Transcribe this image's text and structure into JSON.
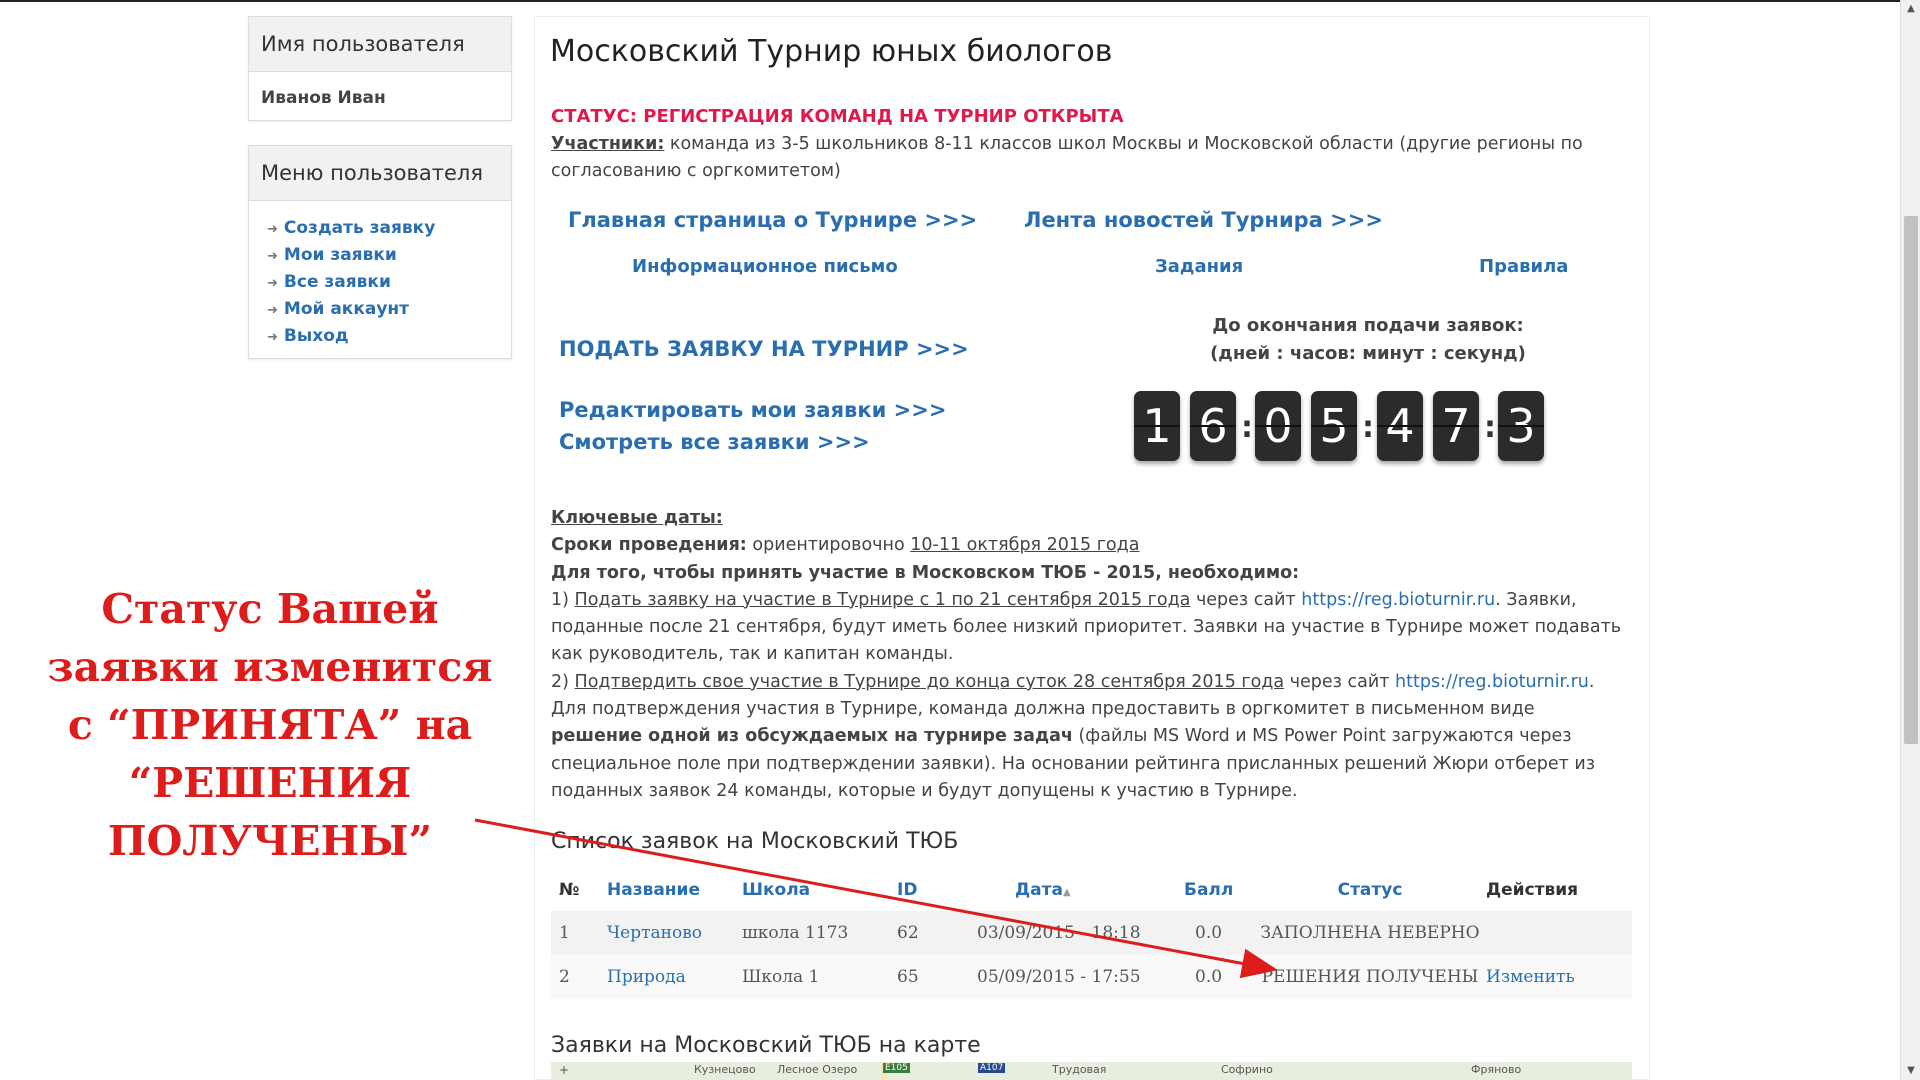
{
  "sidebar": {
    "user_block": {
      "title": "Имя пользователя",
      "name": "Иванов Иван"
    },
    "menu_block": {
      "title": "Меню пользователя",
      "items": [
        "Создать заявку",
        "Мои заявки",
        "Все заявки",
        "Мой аккаунт",
        "Выход"
      ]
    }
  },
  "main": {
    "title": "Московский Турнир юных биологов",
    "status": "СТАТУС: РЕГИСТРАЦИЯ КОМАНД НА ТУРНИР ОТКРЫТА",
    "participants_label": "Участники:",
    "participants_text": " команда из 3-5 школьников 8-11 классов школ Москвы и Московской области (другие регионы по согласованию с оргкомитетом)",
    "links": {
      "home": "Главная страница о Турнире >>>",
      "news": "Лента новостей Турнира >>>",
      "info_letter": "Информационное письмо",
      "tasks": "Задания",
      "rules": "Правила",
      "submit": "ПОДАТЬ ЗАЯВКУ НА ТУРНИР >>>",
      "edit": "Редактировать мои заявки >>>",
      "view_all": "Смотреть все заявки >>>"
    },
    "countdown": {
      "label_line1": "До окончания подачи заявок:",
      "label_line2": "(дней : часов: минут : секунд)",
      "digits": [
        "1",
        "6",
        "0",
        "5",
        "4",
        "7",
        "3"
      ]
    },
    "key_dates": {
      "heading": "Ключевые даты:",
      "period_label": "Сроки проведения:",
      "period_pre": " ориентировочно ",
      "period_dates": "10-11 октября 2015 года",
      "requirement": "Для того, чтобы принять участие в Московском ТЮБ - 2015, необходимо:",
      "step1_num": "1) ",
      "step1_link": "Подать заявку на участие в Турнире с 1 по 21 сентября 2015 года",
      "step1_mid": " через сайт ",
      "site": "https://reg.bioturnir.ru",
      "step1_rest": ". Заявки, поданные после 21 сентября, будут иметь более низкий приоритет. Заявки на участие в Турнире может подавать как руководитель, так и капитан команды.",
      "step2_num": "2) ",
      "step2_link": "Подтвердить свое участие в Турнире до конца суток 28 сентября 2015 года",
      "step2_mid": " через сайт ",
      "step2_after_site": ". Для подтверждения участия в Турнире, команда должна предоставить в оргкомитет в письменном виде ",
      "step2_bold": "решение одной из обсуждаемых на турнире задач",
      "step2_rest": " (файлы MS Word и MS Power Point загружаются через специальное поле при подтверждении заявки). На основании рейтинга присланных решений Жюри отберет из поданных заявок 24 команды, которые и будут допущены к участию в Турнире."
    },
    "list_title": "Список заявок на Московский ТЮБ",
    "table": {
      "headers": [
        "№",
        "Название",
        "Школа",
        "ID",
        "Дата",
        "Балл",
        "Статус",
        "Действия"
      ],
      "sort_icon": "▲",
      "rows": [
        {
          "num": "1",
          "name": "Чертаново",
          "school": "школа 1173",
          "id": "62",
          "date": "03/09/2015 - 18:18",
          "score": "0.0",
          "status": "ЗАПОЛНЕНА НЕВЕРНО",
          "action": ""
        },
        {
          "num": "2",
          "name": "Природа",
          "school": "Школа 1",
          "id": "65",
          "date": "05/09/2015 - 17:55",
          "score": "0.0",
          "status": "РЕШЕНИЯ ПОЛУЧЕНЫ",
          "action": "Изменить"
        }
      ]
    },
    "map_title": "Заявки на Московский ТЮБ на карте",
    "map_labels": [
      "Кузнецово",
      "Лесное Озеро",
      "E105",
      "A107",
      "Трудовая",
      "Софрино",
      "Фряново"
    ]
  },
  "annotation": {
    "lines": [
      "Статус Вашей",
      "заявки изменится",
      "с “ПРИНЯТА” на",
      "“РЕШЕНИЯ ПОЛУЧЕНЫ”"
    ],
    "color": "#dd1c1c"
  }
}
